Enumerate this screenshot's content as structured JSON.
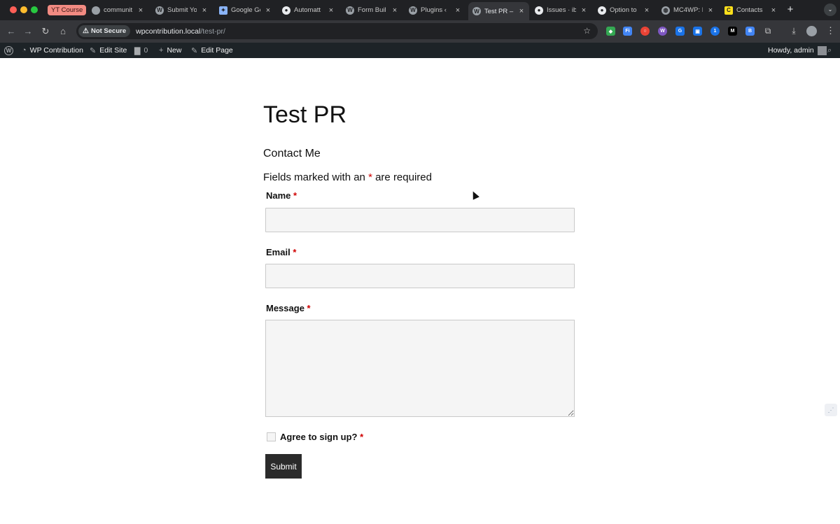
{
  "browser": {
    "tab_group": "YT Course",
    "tabs": [
      {
        "title": "communit",
        "icon": "generic-icon"
      },
      {
        "title": "Submit Yo",
        "icon": "wordpress-icon"
      },
      {
        "title": "Google Ge",
        "icon": "gemini-icon"
      },
      {
        "title": "Automatt",
        "icon": "github-icon"
      },
      {
        "title": "Form Buil",
        "icon": "wordpress-icon"
      },
      {
        "title": "Plugins ‹",
        "icon": "wordpress-icon"
      },
      {
        "title": "Test PR –",
        "icon": "wordpress-icon"
      },
      {
        "title": "Issues · ib",
        "icon": "github-icon"
      },
      {
        "title": "Option to",
        "icon": "github-icon"
      },
      {
        "title": "MC4WP: I",
        "icon": "globe-icon"
      },
      {
        "title": "Contacts",
        "icon": "mailchimp-icon"
      }
    ],
    "security_label": "Not Secure",
    "url_host": "wpcontribution.local",
    "url_path": "/test-pr/"
  },
  "adminbar": {
    "site_name": "WP Contribution",
    "edit_site": "Edit Site",
    "comments_count": "0",
    "new_label": "New",
    "edit_page": "Edit Page",
    "howdy": "Howdy, admin"
  },
  "page": {
    "title": "Test PR",
    "form_title": "Contact Me",
    "required_note_before": "Fields marked with an",
    "required_star": "*",
    "required_note_after": "are required",
    "fields": {
      "name_label": "Name",
      "email_label": "Email",
      "message_label": "Message",
      "agree_label": "Agree to sign up?"
    },
    "submit_label": "Submit"
  },
  "colors": {
    "required": "#d00000",
    "admin_bar": "#1d2327",
    "submit_bg": "#2b2b2b"
  }
}
